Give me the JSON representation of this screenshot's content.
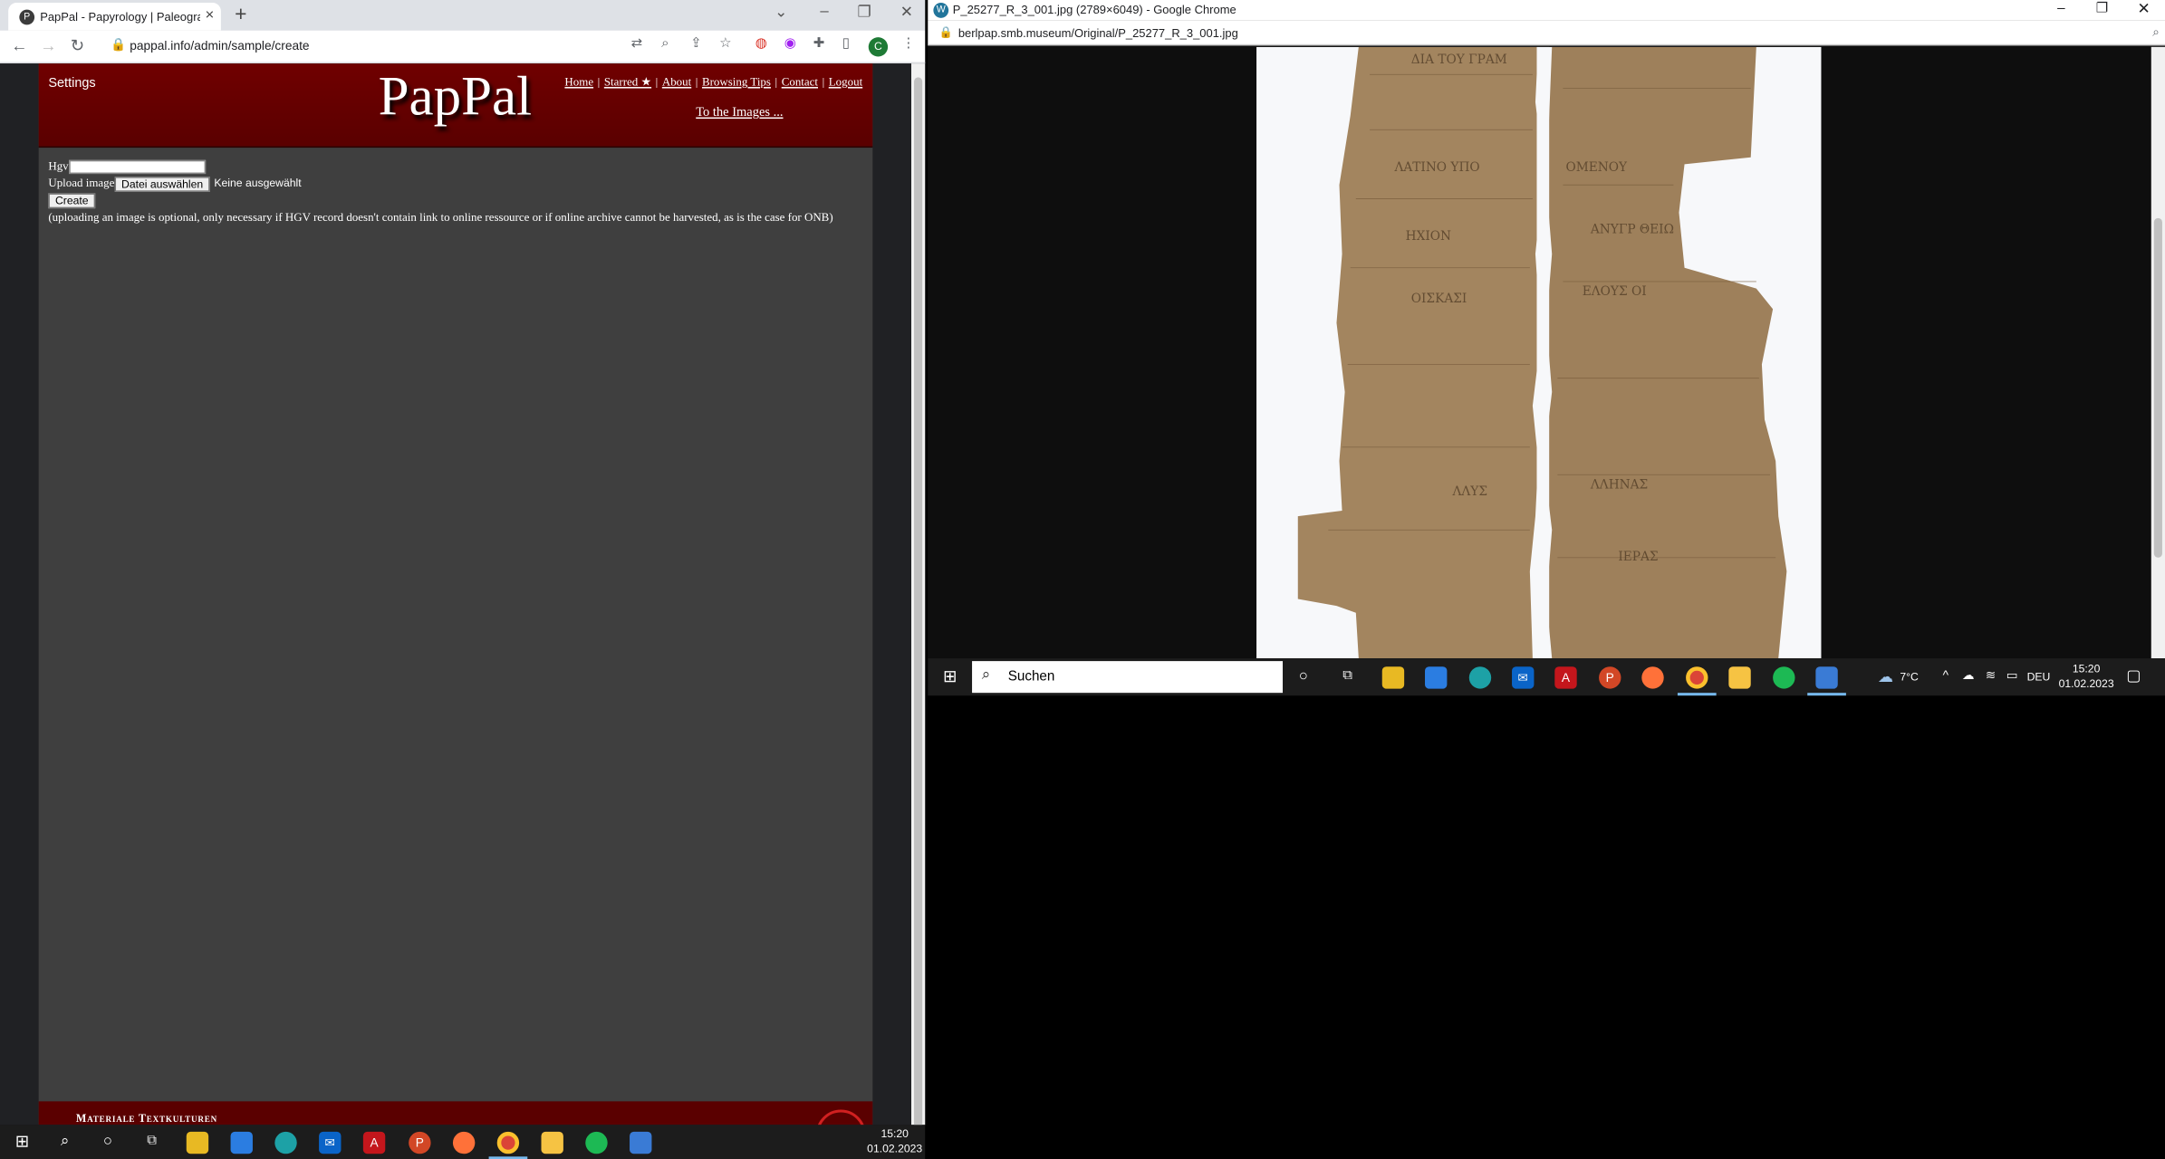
{
  "left_window": {
    "tab_title": "PapPal - Papyrology | Paleograph",
    "favicon": "P",
    "url": "pappal.info/admin/sample/create",
    "profile_initial": "C"
  },
  "site": {
    "settings_label": "Settings",
    "logo": "PapPal",
    "nav": [
      "Home",
      "Starred ★",
      "About",
      "Browsing Tips",
      "Contact",
      "Logout"
    ],
    "to_images": "To the Images ...",
    "footer_text": "Materiale Textkulturen"
  },
  "form": {
    "hgv_label": "Hgv",
    "hgv_value": "",
    "upload_label": "Upload image",
    "file_button": "Datei auswählen",
    "file_status": "Keine ausgewählt",
    "create_button": "Create",
    "note": "(uploading an image is optional, only necessary if HGV record doesn't contain link to online ressource or if online archive cannot be harvested, as is the case for ONB)"
  },
  "right_window": {
    "title": "P_25277_R_3_001.jpg (2789×6049) - Google Chrome",
    "url": "berlpap.smb.museum/Original/P_25277_R_3_001.jpg",
    "image_alt": "papyrus fragment"
  },
  "taskbar_bottom": {
    "time": "15:20",
    "date": "01.02.2023"
  },
  "taskbar_right": {
    "search_placeholder": "Suchen",
    "weather": "7°C",
    "language": "DEU",
    "time": "15:20",
    "date": "01.02.2023"
  },
  "colors": {
    "header_red": "#700000",
    "page_bg": "#3f3f3f",
    "taskbar": "#1c1c1c"
  }
}
